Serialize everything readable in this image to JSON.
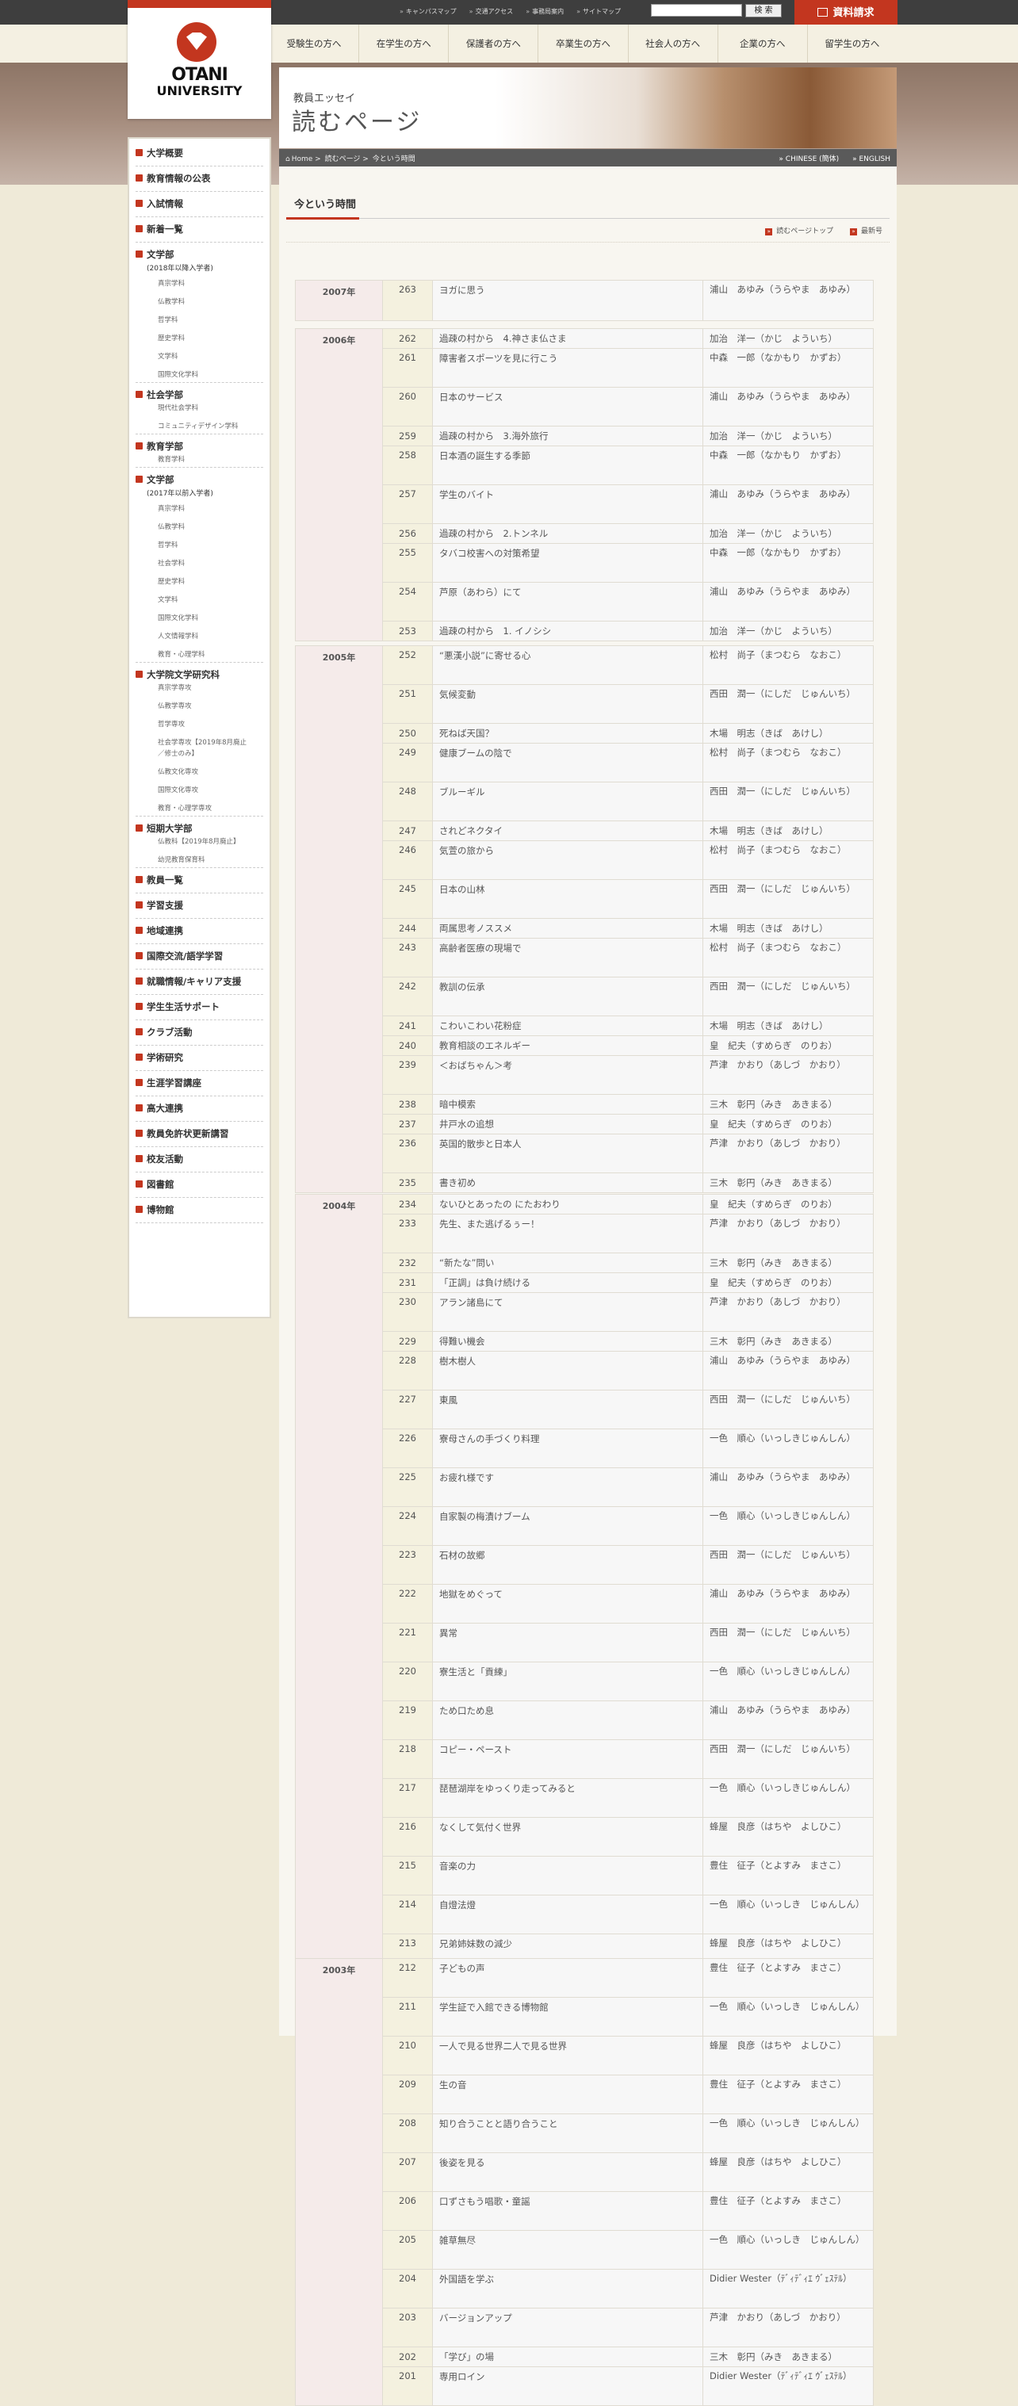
{
  "header": {
    "util_links": [
      "キャンパスマップ",
      "交通アクセス",
      "事務局案内",
      "サイトマップ"
    ],
    "search_button": "検 索",
    "request_button": "資料請求",
    "nav": [
      "受験生の方へ",
      "在学生の方へ",
      "保護者の方へ",
      "卒業生の方へ",
      "社会人の方へ",
      "企業の方へ",
      "留学生の方へ"
    ]
  },
  "logo": {
    "line1": "OTANI",
    "line2": "UNIVERSITY"
  },
  "hero": {
    "subtitle": "教員エッセイ",
    "title": "読むページ"
  },
  "breadcrumb": [
    "Home",
    "読むページ",
    "今という時間"
  ],
  "lang": [
    "CHINESE (簡体)",
    "ENGLISH"
  ],
  "sidebar": {
    "items": [
      {
        "type": "cat",
        "label": "大学概要"
      },
      {
        "type": "cat",
        "label": "教育情報の公表"
      },
      {
        "type": "cat",
        "label": "入試情報"
      },
      {
        "type": "cat",
        "label": "新着一覧"
      },
      {
        "type": "cat",
        "label": "文学部"
      },
      {
        "type": "note",
        "label": "(2018年以降入学者)"
      },
      {
        "type": "sub",
        "label": "真宗学科"
      },
      {
        "type": "sub",
        "label": "仏教学科"
      },
      {
        "type": "sub",
        "label": "哲学科"
      },
      {
        "type": "sub",
        "label": "歴史学科"
      },
      {
        "type": "sub",
        "label": "文学科"
      },
      {
        "type": "sub",
        "label": "国際文化学科"
      },
      {
        "type": "cat",
        "label": "社会学部"
      },
      {
        "type": "sub",
        "label": "現代社会学科"
      },
      {
        "type": "sub",
        "label": "コミュニティデザイン学科"
      },
      {
        "type": "cat",
        "label": "教育学部"
      },
      {
        "type": "sub",
        "label": "教育学科"
      },
      {
        "type": "cat",
        "label": "文学部"
      },
      {
        "type": "note",
        "label": "(2017年以前入学者)"
      },
      {
        "type": "sub",
        "label": "真宗学科"
      },
      {
        "type": "sub",
        "label": "仏教学科"
      },
      {
        "type": "sub",
        "label": "哲学科"
      },
      {
        "type": "sub",
        "label": "社会学科"
      },
      {
        "type": "sub",
        "label": "歴史学科"
      },
      {
        "type": "sub",
        "label": "文学科"
      },
      {
        "type": "sub",
        "label": "国際文化学科"
      },
      {
        "type": "sub",
        "label": "人文情報学科"
      },
      {
        "type": "sub",
        "label": "教育・心理学科"
      },
      {
        "type": "cat",
        "label": "大学院文学研究科"
      },
      {
        "type": "sub",
        "label": "真宗学専攻"
      },
      {
        "type": "sub",
        "label": "仏教学専攻"
      },
      {
        "type": "sub",
        "label": "哲学専攻"
      },
      {
        "type": "sub",
        "label": "社会学専攻【2019年8月廃止"
      },
      {
        "type": "sub",
        "label": "／修士のみ】"
      },
      {
        "type": "sub",
        "label": "仏教文化専攻"
      },
      {
        "type": "sub",
        "label": "国際文化専攻"
      },
      {
        "type": "sub",
        "label": "教育・心理学専攻"
      },
      {
        "type": "cat",
        "label": "短期大学部"
      },
      {
        "type": "sub",
        "label": "仏教科【2019年8月廃止】"
      },
      {
        "type": "sub",
        "label": "幼児教育保育科"
      },
      {
        "type": "cat",
        "label": "教員一覧"
      },
      {
        "type": "cat",
        "label": "学習支援"
      },
      {
        "type": "cat",
        "label": "地域連携"
      },
      {
        "type": "cat",
        "label": "国際交流/語学学習"
      },
      {
        "type": "cat",
        "label": "就職情報/キャリア支援"
      },
      {
        "type": "cat",
        "label": "学生生活サポート"
      },
      {
        "type": "cat",
        "label": "クラブ活動"
      },
      {
        "type": "cat",
        "label": "学術研究"
      },
      {
        "type": "cat",
        "label": "生涯学習講座"
      },
      {
        "type": "cat",
        "label": "高大連携"
      },
      {
        "type": "cat",
        "label": "教員免許状更新講習"
      },
      {
        "type": "cat",
        "label": "校友活動"
      },
      {
        "type": "cat",
        "label": "図書館"
      },
      {
        "type": "cat",
        "label": "博物館"
      }
    ]
  },
  "main": {
    "heading": "今という時間",
    "links": [
      "読むページトップ",
      "最新号"
    ],
    "years": [
      {
        "year": "2007年",
        "rows": [
          [
            "263",
            "ヨガに思う",
            "浦山　あゆみ（うらやま　あゆみ）"
          ]
        ]
      },
      {
        "year": "2006年",
        "rows": [
          [
            "262",
            "過疎の村から　4.神さま仏さま",
            "加治　洋一（かじ　よういち）"
          ],
          [
            "261",
            "障害者スポーツを見に行こう",
            "中森　一郎（なかもり　かずお）"
          ],
          [
            "260",
            "日本のサービス",
            "浦山　あゆみ（うらやま　あゆみ）"
          ],
          [
            "259",
            "過疎の村から　3.海外旅行",
            "加治　洋一（かじ　よういち）"
          ],
          [
            "258",
            "日本酒の誕生する季節",
            "中森　一郎（なかもり　かずお）"
          ],
          [
            "257",
            "学生のバイト",
            "浦山　あゆみ（うらやま　あゆみ）"
          ],
          [
            "256",
            "過疎の村から　2.トンネル",
            "加治　洋一（かじ　よういち）"
          ],
          [
            "255",
            "タバコ校害への対策希望",
            "中森　一郎（なかもり　かずお）"
          ],
          [
            "254",
            "芦原（あわら）にて",
            "浦山　あゆみ（うらやま　あゆみ）"
          ],
          [
            "253",
            "過疎の村から　1. イノシシ",
            "加治　洋一（かじ　よういち）"
          ]
        ]
      },
      {
        "year": "2005年",
        "rows": [
          [
            "252",
            "“悪漢小説”に寄せる心",
            "松村　尚子（まつむら　なおこ）"
          ],
          [
            "251",
            "気候変動",
            "西田　潤一（にしだ　じゅんいち）"
          ],
          [
            "250",
            "死ねば天国？",
            "木場　明志（きば　あけし）"
          ],
          [
            "249",
            "健康ブームの陰で",
            "松村　尚子（まつむら　なおこ）"
          ],
          [
            "248",
            "ブルーギル",
            "西田　潤一（にしだ　じゅんいち）"
          ],
          [
            "247",
            "されどネクタイ",
            "木場　明志（きば　あけし）"
          ],
          [
            "246",
            "気萱の旅から",
            "松村　尚子（まつむら　なおこ）"
          ],
          [
            "245",
            "日本の山林",
            "西田　潤一（にしだ　じゅんいち）"
          ],
          [
            "244",
            "両属思考ノススメ",
            "木場　明志（きば　あけし）"
          ],
          [
            "243",
            "高齢者医療の現場で",
            "松村　尚子（まつむら　なおこ）"
          ],
          [
            "242",
            "教訓の伝承",
            "西田　潤一（にしだ　じゅんいち）"
          ],
          [
            "241",
            "こわいこわい花粉症",
            "木場　明志（きば　あけし）"
          ],
          [
            "240",
            "教育相談のエネルギー",
            "皇　紀夫（すめらぎ　のりお）"
          ],
          [
            "239",
            "＜おばちゃん＞考",
            "芦津　かおり（あしづ　かおり）"
          ],
          [
            "238",
            "暗中模索",
            "三木　彰円（みき　あきまる）"
          ],
          [
            "237",
            "井戸水の追想",
            "皇　紀夫（すめらぎ　のりお）"
          ],
          [
            "236",
            "英国的散歩と日本人",
            "芦津　かおり（あしづ　かおり）"
          ],
          [
            "235",
            "書き初め",
            "三木　彰円（みき　あきまる）"
          ]
        ]
      },
      {
        "year": "2004年",
        "rows": [
          [
            "234",
            "ないひとあったの にたおわり",
            "皇　紀夫（すめらぎ　のりお）"
          ],
          [
            "233",
            "先生、また逃げるぅー！",
            "芦津　かおり（あしづ　かおり）"
          ],
          [
            "232",
            "“新たな”問い",
            "三木　彰円（みき　あきまる）"
          ],
          [
            "231",
            "「正調」は負け続ける",
            "皇　紀夫（すめらぎ　のりお）"
          ],
          [
            "230",
            "アラン諸島にて",
            "芦津　かおり（あしづ　かおり）"
          ],
          [
            "229",
            "得難い機会",
            "三木　彰円（みき　あきまる）"
          ],
          [
            "228",
            "樹木樹人",
            "浦山　あゆみ（うらやま　あゆみ）"
          ],
          [
            "227",
            "東風",
            "西田　潤一（にしだ　じゅんいち）"
          ],
          [
            "226",
            "寮母さんの手づくり料理",
            "一色　順心（いっしきじゅんしん）"
          ],
          [
            "225",
            "お疲れ様です",
            "浦山　あゆみ（うらやま　あゆみ）"
          ],
          [
            "224",
            "自家製の梅漬けブーム",
            "一色　順心（いっしきじゅんしん）"
          ],
          [
            "223",
            "石材の故郷",
            "西田　潤一（にしだ　じゅんいち）"
          ],
          [
            "222",
            "地獄をめぐって",
            "浦山　あゆみ（うらやま　あゆみ）"
          ],
          [
            "221",
            "異常",
            "西田　潤一（にしだ　じゅんいち）"
          ],
          [
            "220",
            "寮生活と「貢練」",
            "一色　順心（いっしきじゅんしん）"
          ],
          [
            "219",
            "ため口ため息",
            "浦山　あゆみ（うらやま　あゆみ）"
          ],
          [
            "218",
            "コピー・ペースト",
            "西田　潤一（にしだ　じゅんいち）"
          ],
          [
            "217",
            "琵琶湖岸をゆっくり走ってみると",
            "一色　順心（いっしきじゅんしん）"
          ],
          [
            "216",
            "なくして気付く世界",
            "蜂屋　良彦（はちや　よしひこ）"
          ],
          [
            "215",
            "音楽の力",
            "豊住　征子（とよすみ　まさこ）"
          ],
          [
            "214",
            "自燈法燈",
            "一色　順心（いっしき　じゅんしん）"
          ],
          [
            "213",
            "兄弟姉妹数の減少",
            "蜂屋　良彦（はちや　よしひこ）"
          ]
        ]
      },
      {
        "year": "2003年",
        "rows": [
          [
            "212",
            "子どもの声",
            "豊住　征子（とよすみ　まさこ）"
          ],
          [
            "211",
            "学生証で入館できる博物館",
            "一色　順心（いっしき　じゅんしん）"
          ],
          [
            "210",
            "一人で見る世界二人で見る世界",
            "蜂屋　良彦（はちや　よしひこ）"
          ],
          [
            "209",
            "生の音",
            "豊住　征子（とよすみ　まさこ）"
          ],
          [
            "208",
            "知り合うことと語り合うこと",
            "一色　順心（いっしき　じゅんしん）"
          ],
          [
            "207",
            "後姿を見る",
            "蜂屋　良彦（はちや　よしひこ）"
          ],
          [
            "206",
            "口ずさもう唱歌・童謡",
            "豊住　征子（とよすみ　まさこ）"
          ],
          [
            "205",
            "雑草無尽",
            "一色　順心（いっしき　じゅんしん）"
          ],
          [
            "204",
            "外国語を学ぶ",
            "Didier Wester（ﾃﾞｨﾃﾞｨｴ ｳﾞｪｽﾃﾙ）"
          ],
          [
            "203",
            "バージョンアップ",
            "芦津　かおり（あしづ　かおり）"
          ],
          [
            "202",
            "「学び」の場",
            "三木　彰円（みき　あきまる）"
          ],
          [
            "201",
            "専用ロイン",
            "Didier Wester（ﾃﾞｨﾃﾞｨｴ ｳﾞｪｽﾃﾙ）"
          ]
        ]
      }
    ]
  }
}
